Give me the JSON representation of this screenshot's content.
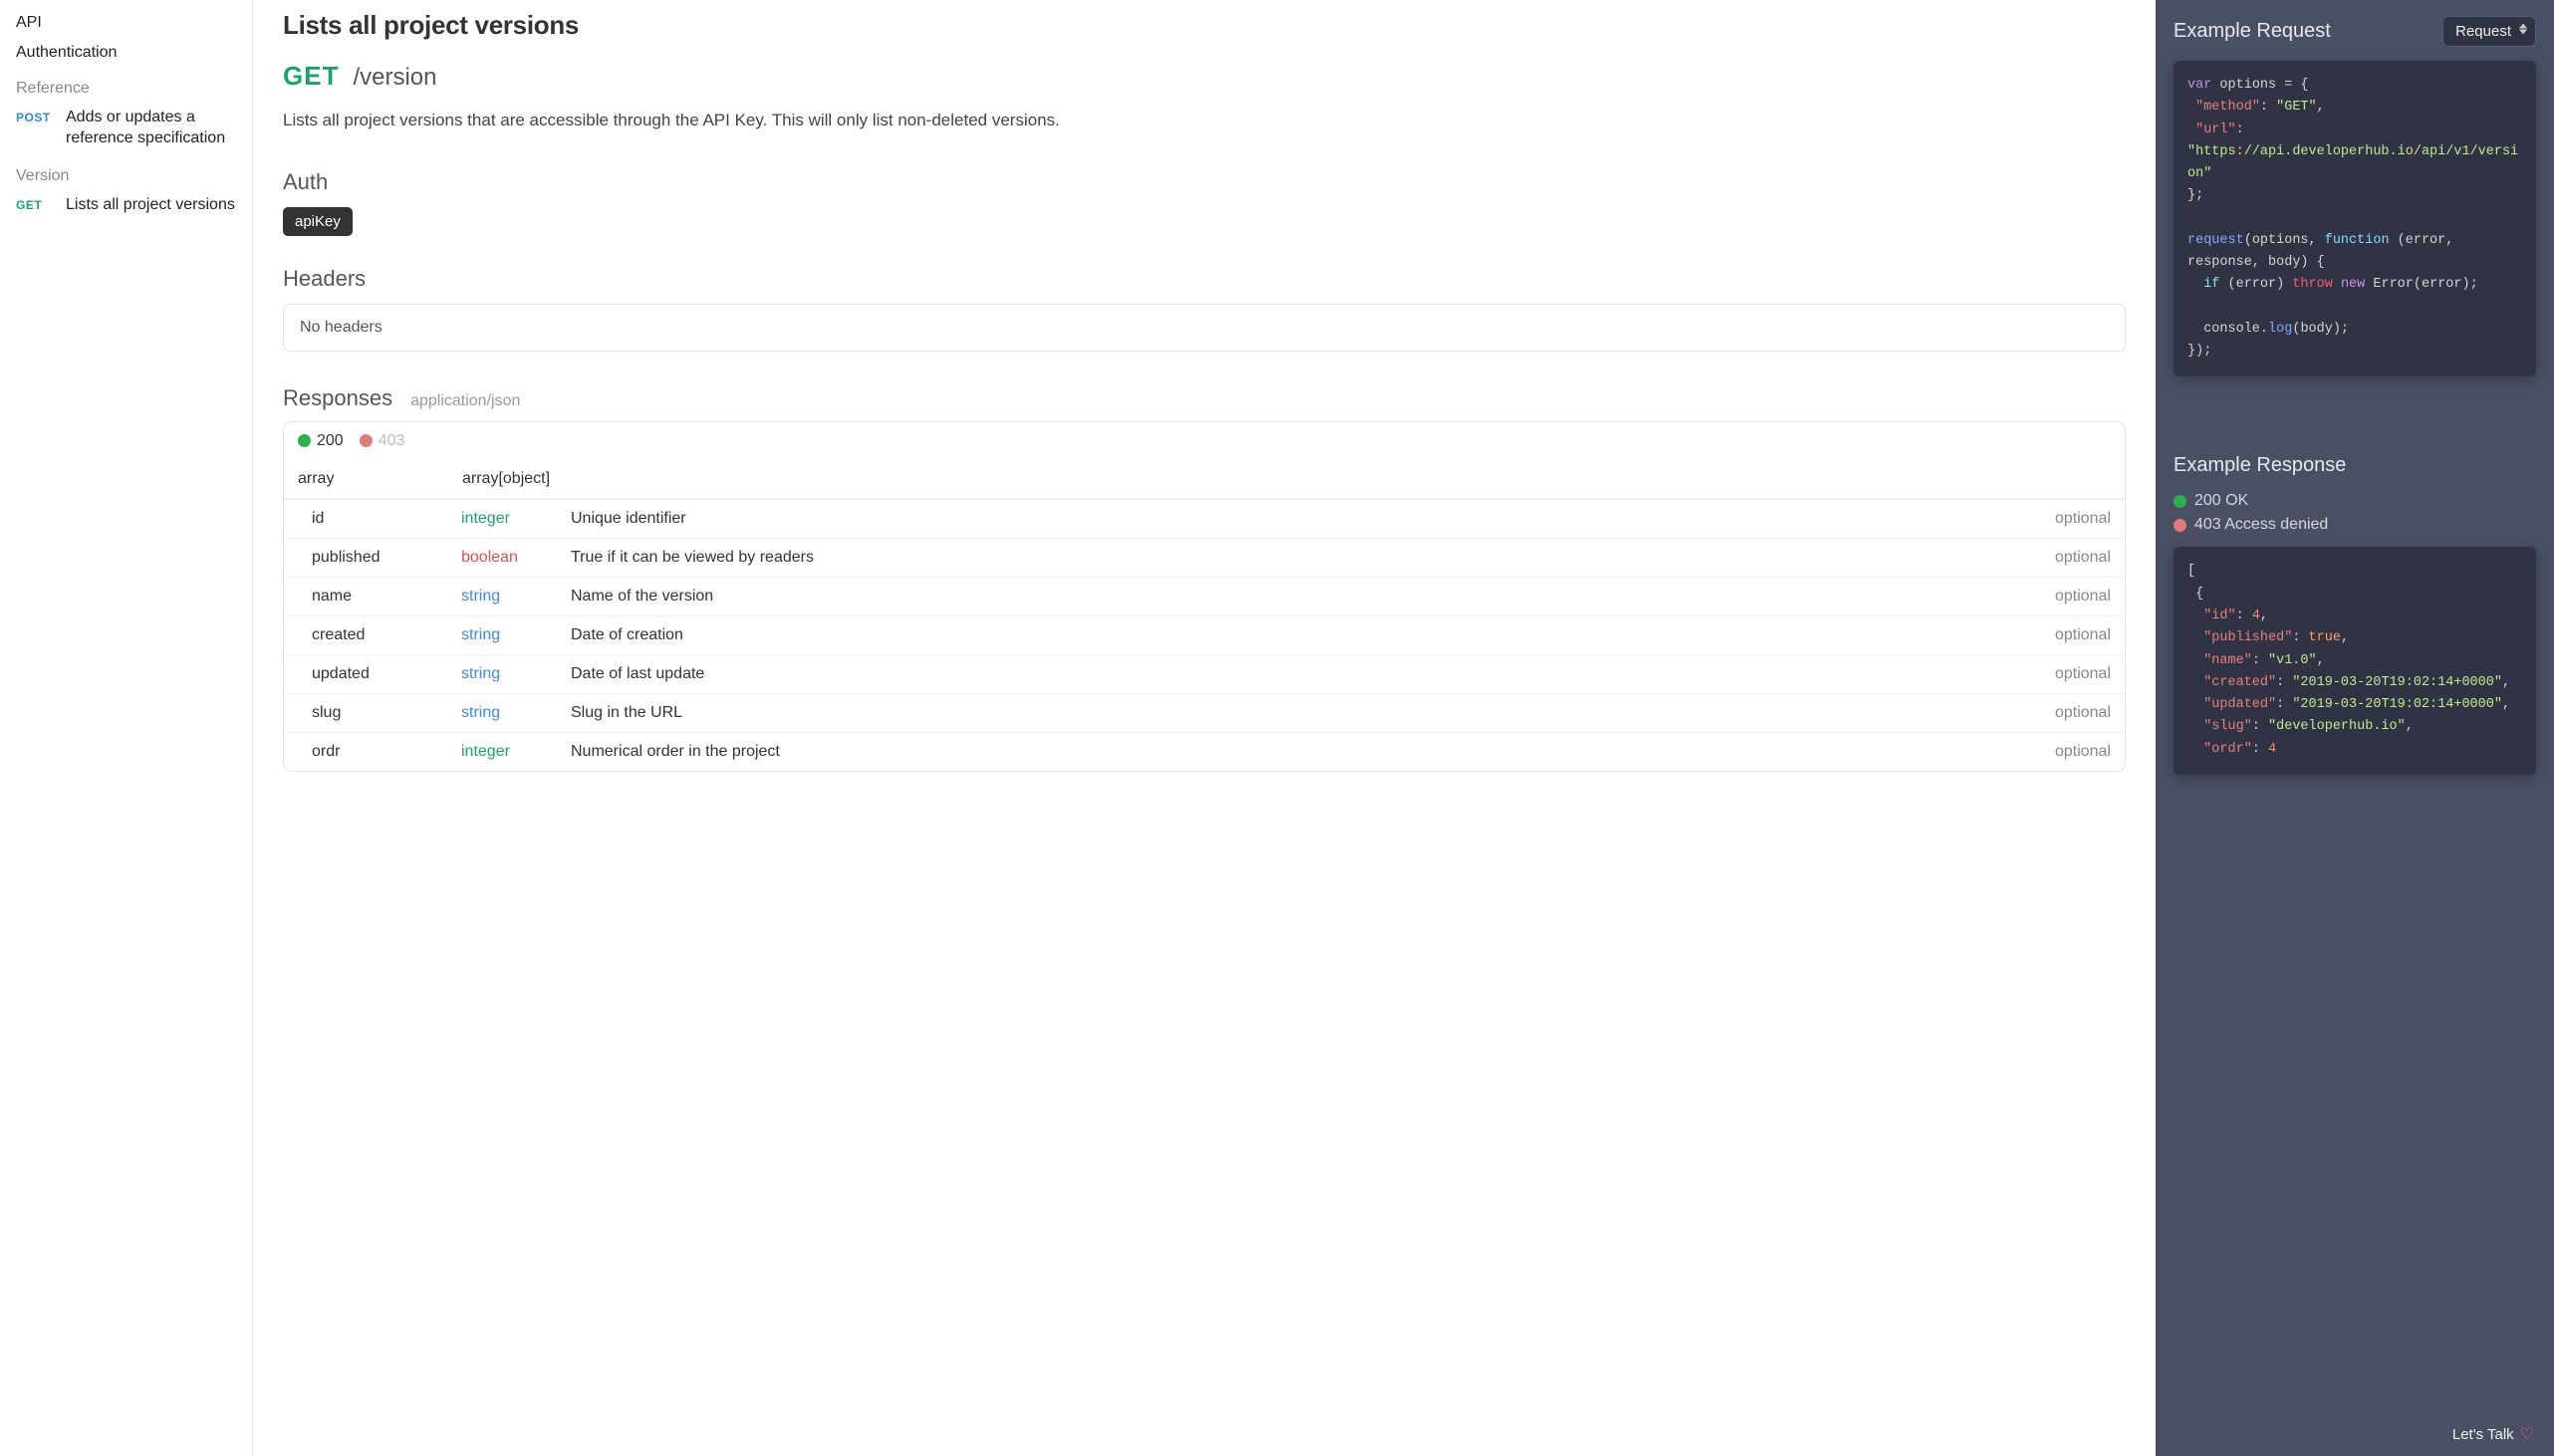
{
  "sidebar": {
    "items": [
      {
        "label": "API",
        "kind": "link"
      },
      {
        "label": "Authentication",
        "kind": "link"
      }
    ],
    "sections": [
      {
        "heading": "Reference",
        "endpoints": [
          {
            "method": "POST",
            "methodClass": "method-post",
            "label": "Adds or updates a reference specification"
          }
        ]
      },
      {
        "heading": "Version",
        "endpoints": [
          {
            "method": "GET",
            "methodClass": "method-get",
            "label": "Lists all project versions"
          }
        ]
      }
    ]
  },
  "main": {
    "title": "Lists all project versions",
    "method": "GET",
    "path": "/version",
    "description": "Lists all project versions that are accessible through the API Key. This will only list non-deleted versions.",
    "auth_heading": "Auth",
    "auth_badge": "apiKey",
    "headers_heading": "Headers",
    "headers_empty": "No headers",
    "responses_heading": "Responses",
    "content_type": "application/json",
    "status_tabs": [
      {
        "code": "200",
        "dot": "dot-green",
        "active": true
      },
      {
        "code": "403",
        "dot": "dot-red",
        "active": false
      }
    ],
    "array_label": "array",
    "array_type": "array[object]",
    "properties": [
      {
        "name": "id",
        "type": "integer",
        "typeClass": "type-integer",
        "desc": "Unique identifier",
        "req": "optional"
      },
      {
        "name": "published",
        "type": "boolean",
        "typeClass": "type-boolean",
        "desc": "True if it can be viewed by readers",
        "req": "optional"
      },
      {
        "name": "name",
        "type": "string",
        "typeClass": "type-string",
        "desc": "Name of the version",
        "req": "optional"
      },
      {
        "name": "created",
        "type": "string",
        "typeClass": "type-string",
        "desc": "Date of creation",
        "req": "optional"
      },
      {
        "name": "updated",
        "type": "string",
        "typeClass": "type-string",
        "desc": "Date of last update",
        "req": "optional"
      },
      {
        "name": "slug",
        "type": "string",
        "typeClass": "type-string",
        "desc": "Slug in the URL",
        "req": "optional"
      },
      {
        "name": "ordr",
        "type": "integer",
        "typeClass": "type-integer",
        "desc": "Numerical order in the project",
        "req": "optional"
      }
    ]
  },
  "right": {
    "request_title": "Example Request",
    "dropdown_label": "Request",
    "request_code": {
      "var": "var",
      "options": "options",
      "method_key": "\"method\"",
      "method_val": "\"GET\"",
      "url_key": "\"url\"",
      "url_val": "\"https://api.developerhub.io/api/v1/version\"",
      "request_fn": "request",
      "function_kw": "function",
      "args": "(error, response, body)",
      "if_kw": "if",
      "throw_kw": "throw",
      "new_kw": "new",
      "error_ctor": "Error",
      "console": "console",
      "log": "log",
      "body": "body"
    },
    "response_title": "Example Response",
    "response_statuses": [
      {
        "label": "200 OK",
        "dot": "dot-green"
      },
      {
        "label": "403 Access denied",
        "dot": "dot-red"
      }
    ],
    "response_body": {
      "id_key": "\"id\"",
      "id_val": "4",
      "published_key": "\"published\"",
      "published_val": "true",
      "name_key": "\"name\"",
      "name_val": "\"v1.0\"",
      "created_key": "\"created\"",
      "created_val": "\"2019-03-20T19:02:14+0000\"",
      "updated_key": "\"updated\"",
      "updated_val": "\"2019-03-20T19:02:14+0000\"",
      "slug_key": "\"slug\"",
      "slug_val": "\"developerhub.io\"",
      "ordr_key": "\"ordr\"",
      "ordr_val": "4"
    },
    "lets_talk": "Let's Talk"
  }
}
